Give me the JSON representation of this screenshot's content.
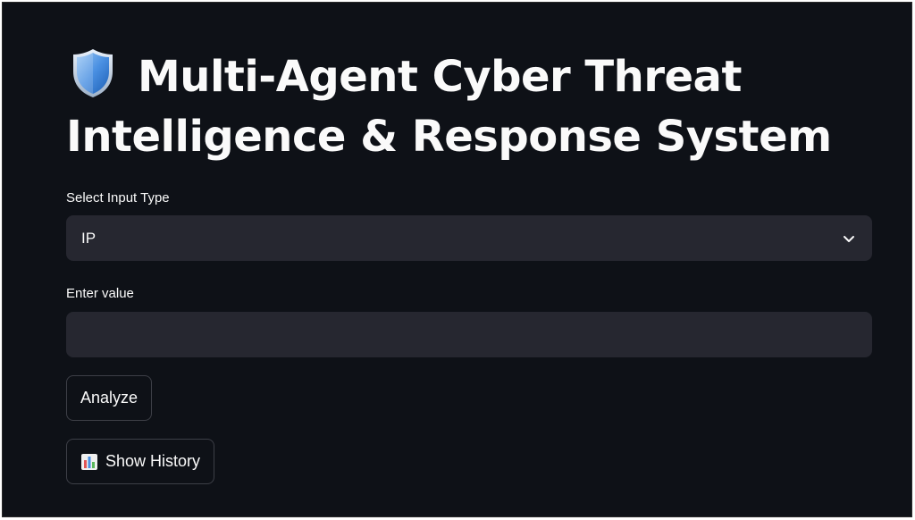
{
  "header": {
    "icon": "shield-icon",
    "title_line1": "Multi-Agent Cyber Threat",
    "title_line2": "Intelligence & Response System"
  },
  "form": {
    "input_type": {
      "label": "Select Input Type",
      "selected": "IP"
    },
    "value_field": {
      "label": "Enter value",
      "value": "",
      "placeholder": ""
    },
    "analyze_label": "Analyze",
    "history_label": "Show History",
    "history_icon": "bar-chart-icon"
  },
  "colors": {
    "background": "#0e1117",
    "input_background": "#262730",
    "text": "#fafafa",
    "button_border": "#3d3f47",
    "shield_blue": "#4a90e2"
  }
}
